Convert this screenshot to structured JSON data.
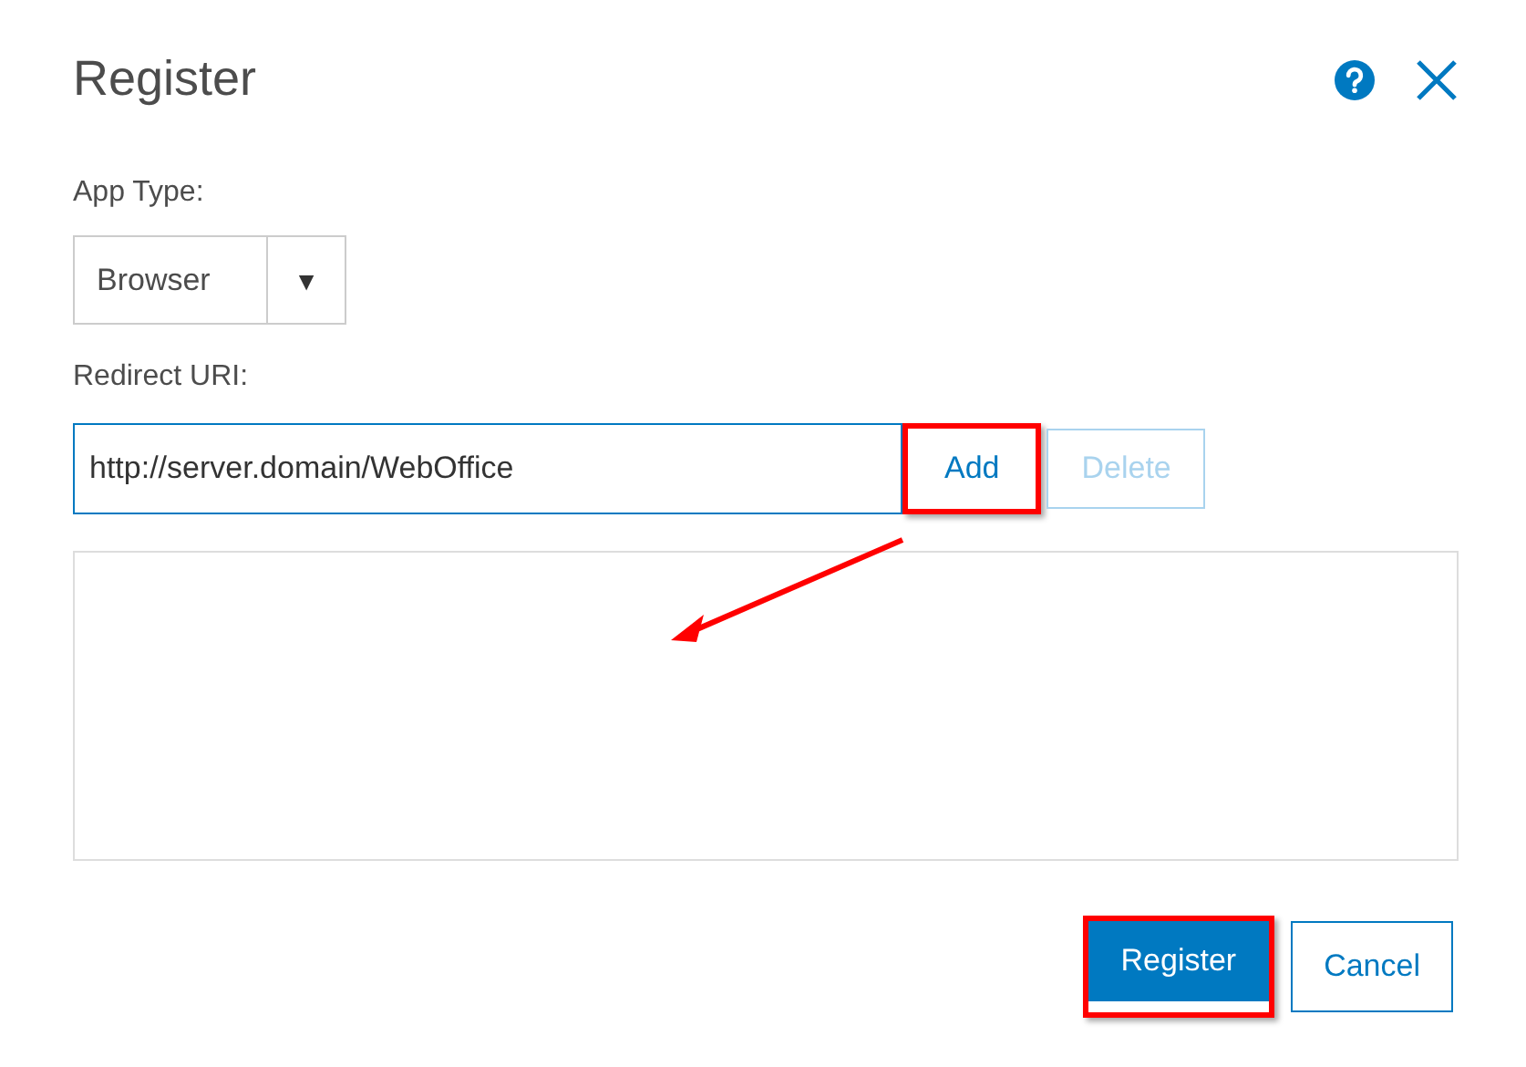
{
  "dialog": {
    "title": "Register"
  },
  "app_type": {
    "label": "App Type:",
    "value": "Browser",
    "caret": "▼"
  },
  "redirect": {
    "label": "Redirect URI:",
    "value": "http://server.domain/WebOffice",
    "buttons": [
      {
        "label": "Add",
        "disabled": false,
        "highlighted": true
      },
      {
        "label": "Delete",
        "disabled": true,
        "highlighted": false
      }
    ]
  },
  "footer": [
    {
      "label": "Register",
      "kind": "primary",
      "highlighted": true
    },
    {
      "label": "Cancel",
      "kind": "secondary",
      "highlighted": false
    }
  ]
}
